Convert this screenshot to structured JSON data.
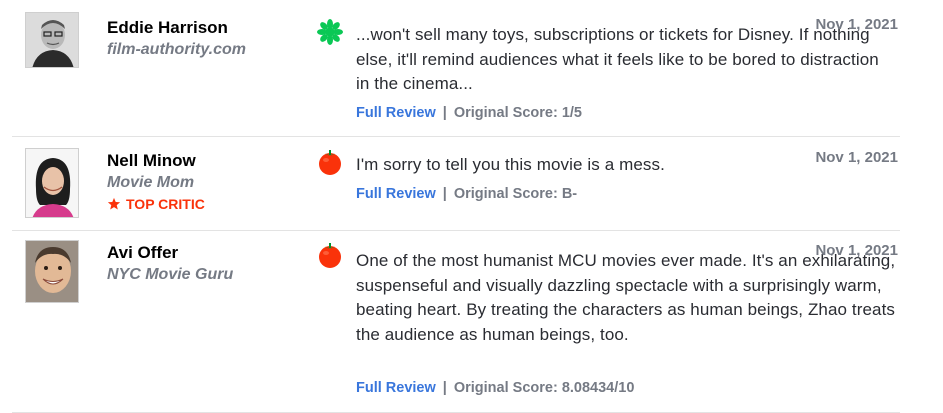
{
  "reviews": [
    {
      "critic": "Eddie Harrison",
      "publication": "film-authority.com",
      "top_critic": false,
      "score_icon": "rotten-splat-icon",
      "quote": "...won't sell many toys, subscriptions or tickets for Disney. If nothing else, it'll remind audiences what it feels like to be bored to distraction in the cinema...",
      "date": "Nov 1, 2021",
      "full_review_label": "Full Review",
      "separator": "|",
      "original_score": "Original Score: 1/5"
    },
    {
      "critic": "Nell Minow",
      "publication": "Movie Mom",
      "top_critic": true,
      "top_critic_label": "TOP CRITIC",
      "score_icon": "fresh-tomato-icon",
      "quote": "I'm sorry to tell you this movie is a mess.",
      "date": "Nov 1, 2021",
      "full_review_label": "Full Review",
      "separator": "|",
      "original_score": "Original Score: B-"
    },
    {
      "critic": "Avi Offer",
      "publication": "NYC Movie Guru",
      "top_critic": false,
      "score_icon": "fresh-tomato-icon",
      "quote": "One of the most humanist MCU movies ever made. It's an exhilarating, suspenseful and visually dazzling spectacle with a surprisingly warm, beating heart. By treating the characters as human beings, Zhao treats the audience as human beings, too.",
      "date": "Nov 1, 2021",
      "full_review_label": "Full Review",
      "separator": "|",
      "original_score": "Original Score: 8.08434/10"
    }
  ],
  "colors": {
    "link": "#3976dc",
    "muted": "#757a84",
    "top_critic": "#fa320a",
    "tomato": "#fa320a",
    "splat": "#0ac855"
  }
}
